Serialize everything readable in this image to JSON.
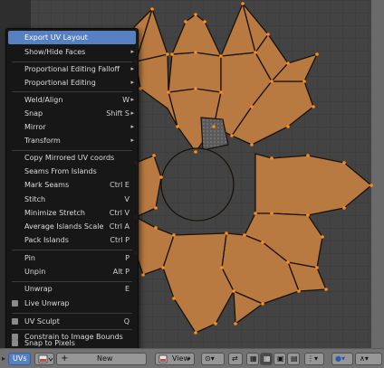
{
  "menu": {
    "items": [
      {
        "label": "Export UV Layout",
        "shortcut": "",
        "submenu": false,
        "highlighted": true
      },
      {
        "label": "Show/Hide Faces",
        "shortcut": "",
        "submenu": true
      },
      {
        "label": "Proportional Editing Falloff",
        "shortcut": "",
        "submenu": true
      },
      {
        "label": "Proportional Editing",
        "shortcut": "",
        "submenu": true
      },
      {
        "label": "Weld/Align",
        "shortcut": "W",
        "submenu": true
      },
      {
        "label": "Snap",
        "shortcut": "Shift S",
        "submenu": true
      },
      {
        "label": "Mirror",
        "shortcut": "",
        "submenu": true
      },
      {
        "label": "Transform",
        "shortcut": "",
        "submenu": true
      },
      {
        "label": "Copy Mirrored UV coords",
        "shortcut": "",
        "submenu": false
      },
      {
        "label": "Seams From Islands",
        "shortcut": "",
        "submenu": false
      },
      {
        "label": "Mark Seams",
        "shortcut": "Ctrl E",
        "submenu": false
      },
      {
        "label": "Stitch",
        "shortcut": "V",
        "submenu": false
      },
      {
        "label": "Minimize Stretch",
        "shortcut": "Ctrl V",
        "submenu": false
      },
      {
        "label": "Average Islands Scale",
        "shortcut": "Ctrl A",
        "submenu": false
      },
      {
        "label": "Pack Islands",
        "shortcut": "Ctrl P",
        "submenu": false
      },
      {
        "label": "Pin",
        "shortcut": "P",
        "submenu": false
      },
      {
        "label": "Unpin",
        "shortcut": "Alt P",
        "submenu": false
      },
      {
        "label": "Unwrap",
        "shortcut": "E",
        "submenu": false
      },
      {
        "label": "Live Unwrap",
        "shortcut": "",
        "submenu": false,
        "checkbox": true
      },
      {
        "label": "UV Sculpt",
        "shortcut": "Q",
        "submenu": false,
        "checkbox": true
      },
      {
        "label": "Constrain to Image Bounds",
        "shortcut": "",
        "submenu": false,
        "checkbox": true
      },
      {
        "label": "Snap to Pixels",
        "shortcut": "",
        "submenu": false,
        "checkbox": true
      }
    ]
  },
  "header": {
    "uvs_menu": "UVs",
    "new_button": "New",
    "view_dropdown": "View",
    "add_icon": "plus-icon",
    "image_icon": "image-icon"
  },
  "colors": {
    "background": "#434343",
    "grid_line": "#3a3a3a",
    "face_fill": "#b87a40",
    "edge": "#1a1208",
    "vertex": "#ff8c1a",
    "menu_bg": "#141414",
    "menu_highlight": "#5680c2",
    "header_bg": "#727272"
  }
}
